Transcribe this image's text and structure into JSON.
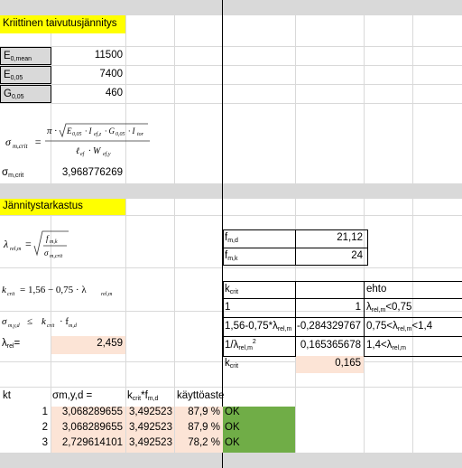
{
  "section1": {
    "title": "Kriittinen taivutusjännitys",
    "rows": [
      {
        "label": "E",
        "sub": "0,mean",
        "value": "11500"
      },
      {
        "label": "E",
        "sub": "0,05",
        "value": "7400"
      },
      {
        "label": "G",
        "sub": "0,05",
        "value": "460"
      }
    ],
    "crit_label": "σ",
    "crit_sub": "m,crit",
    "crit_value": "3,968776269"
  },
  "section2": {
    "title": "Jännitystarkastus",
    "lambda_label": "λ",
    "lambda_sub": "rel",
    "lambda_suffix": "=",
    "lambda_value": "2,459"
  },
  "side": {
    "fmd_label": "f",
    "fmd_sub": "m,d",
    "fmd_value": "21,12",
    "fmk_label": "f",
    "fmk_sub": "m,k",
    "fmk_value": "24",
    "kcrit_header": "k",
    "kcrit_header_sub": "crit",
    "ehto_header": "ehto",
    "rows": [
      {
        "a": "1",
        "b": "1",
        "c": "λ",
        "c_sub": "rel,m",
        "c_rest": "<0,75"
      },
      {
        "a": "1,56-0,75*λ",
        "a_sub": "rel,m",
        "b": "-0,284329767",
        "c": "0,75<λ",
        "c_sub": "rel,m",
        "c_rest": "<1,4"
      },
      {
        "a": "1/λ",
        "a_sub": "rel,m",
        "a_sup": "2",
        "b": "0,165365678",
        "c": "1,4<λ",
        "c_sub": "rel,m",
        "c_rest": ""
      }
    ],
    "kcrit_result_label": "k",
    "kcrit_result_sub": "crit",
    "kcrit_result_value": "0,165"
  },
  "table": {
    "headers": {
      "kt": "kt",
      "sigma": "σm,y,d =",
      "kf": "k",
      "kf_sub": "crit",
      "kf_rest": "*f",
      "kf_sub2": "m,d",
      "kaytto": "käyttöaste"
    },
    "rows": [
      {
        "kt": "1",
        "sigma": "3,068289655",
        "kf": "3,492523",
        "pct": "87,9 %",
        "status": "OK"
      },
      {
        "kt": "2",
        "sigma": "3,068289655",
        "kf": "3,492523",
        "pct": "87,9 %",
        "status": "OK"
      },
      {
        "kt": "3",
        "sigma": "2,729614101",
        "kf": "3,492523",
        "pct": "78,2 %",
        "status": "OK"
      }
    ]
  },
  "formulas": {
    "sigma_crit": "σm,crit = π·√(E0,05·Ief,z·G0,05·Itor) / (ℓef·Wef,y)",
    "lambda_rel": "λrel,m = √(fm,k / σm,crit)",
    "kcrit_formula": "kcrit = 1,56 − 0,75 · λrel,m",
    "check": "σm,y,d ≤ kcrit · fm,d"
  },
  "colors": {
    "yellow": "#ffff00",
    "gray": "#d9d9d9",
    "peach": "#fce4d6",
    "green": "#70ad47"
  }
}
